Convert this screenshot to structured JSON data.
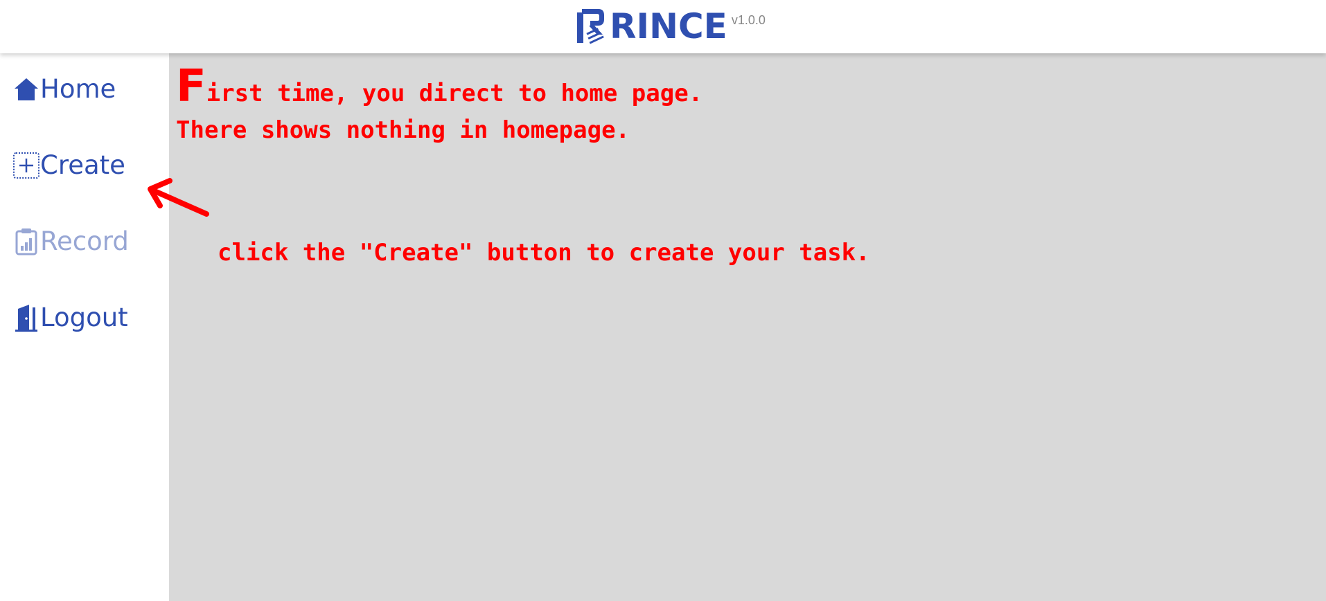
{
  "header": {
    "app_name": "RINCE",
    "version": "v1.0.0"
  },
  "sidebar": {
    "items": [
      {
        "label": "Home",
        "icon": "home-icon"
      },
      {
        "label": "Create",
        "icon": "plus-square-icon"
      },
      {
        "label": "Record",
        "icon": "clipboard-chart-icon"
      },
      {
        "label": "Logout",
        "icon": "door-icon"
      }
    ]
  },
  "annotations": {
    "line1_initial": "F",
    "line1_rest": "irst time, you direct to home page.",
    "line2": "There shows nothing in homepage.",
    "line3": "click the \"Create\" button to create your task."
  },
  "colors": {
    "brand": "#2f4fb0",
    "nav_disabled": "#97a6d4",
    "annotation": "#ff0000",
    "main_bg": "#d9d9d9"
  }
}
